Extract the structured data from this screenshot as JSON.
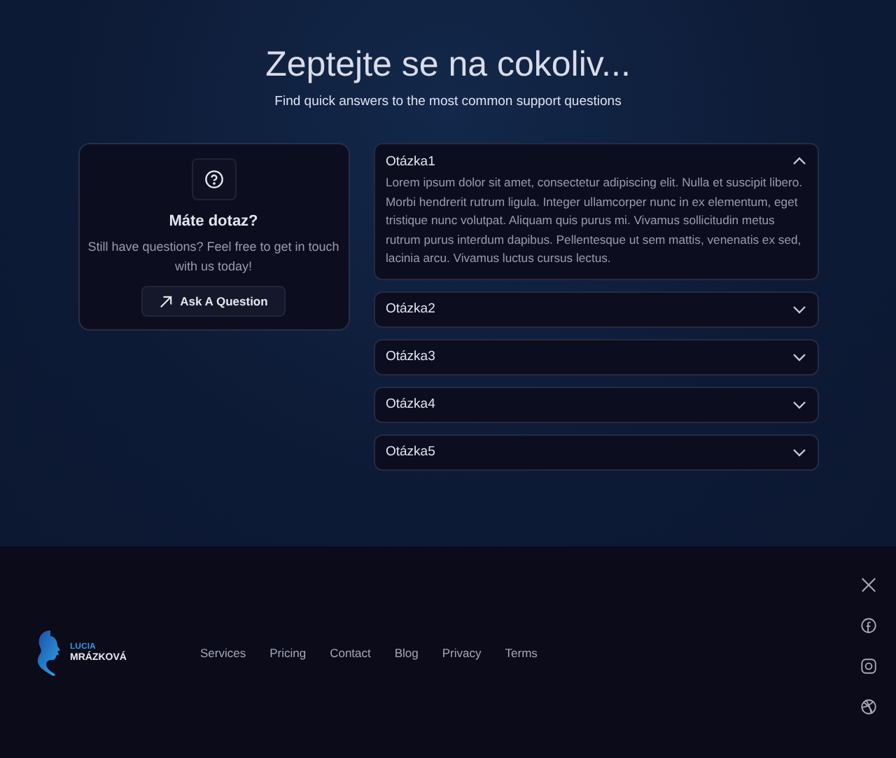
{
  "hero": {
    "title": "Zeptejte se na cokoliv...",
    "subtitle": "Find quick answers to the most common support questions"
  },
  "contact_card": {
    "title": "Máte dotaz?",
    "text": "Still have questions? Feel free to get in touch with us today!",
    "button": "Ask A Question"
  },
  "faq": [
    {
      "question": "Otázka1",
      "expanded": true,
      "answer": "Lorem ipsum dolor sit amet, consectetur adipiscing elit. Nulla et suscipit libero. Morbi hendrerit rutrum ligula. Integer ullamcorper nunc in ex elementum, eget tristique nunc volutpat. Aliquam quis purus mi. Vivamus sollicitudin metus rutrum purus interdum dapibus. Pellentesque ut sem mattis, venenatis ex sed, lacinia arcu. Vivamus luctus cursus lectus."
    },
    {
      "question": "Otázka2",
      "expanded": false
    },
    {
      "question": "Otázka3",
      "expanded": false
    },
    {
      "question": "Otázka4",
      "expanded": false
    },
    {
      "question": "Otázka5",
      "expanded": false
    }
  ],
  "footer": {
    "logo": {
      "first_name": "LUCIA",
      "last_name": "MRÁZKOVÁ"
    },
    "links": [
      "Services",
      "Pricing",
      "Contact",
      "Blog",
      "Privacy",
      "Terms"
    ],
    "social": [
      {
        "kind": "x"
      },
      {
        "kind": "facebook"
      },
      {
        "kind": "instagram"
      },
      {
        "kind": "dribbble"
      }
    ]
  }
}
